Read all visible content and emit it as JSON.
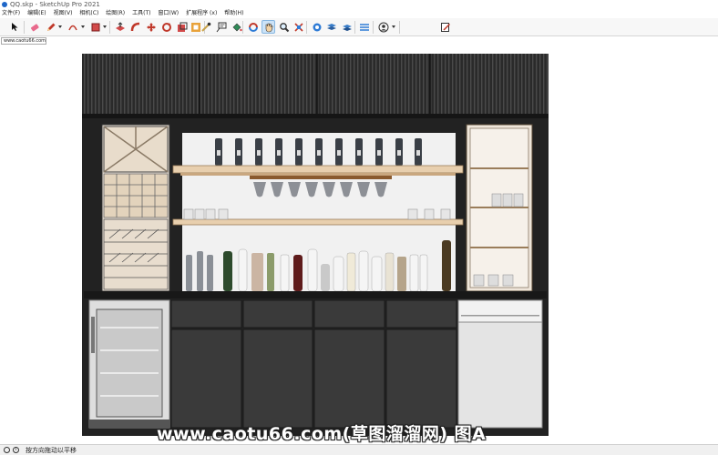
{
  "window": {
    "title": "QQ.skp - SketchUp Pro 2021"
  },
  "menu": [
    "文件(F)",
    "编辑(E)",
    "视图(V)",
    "相机(C)",
    "绘图(R)",
    "工具(T)",
    "窗口(W)",
    "扩展程序 (x)",
    "帮助(H)"
  ],
  "toolbar": {
    "tools": [
      "select-icon",
      "eraser-icon",
      "pencil-icon",
      "arc-icon",
      "shape-icon",
      "push-pull-icon",
      "follow-me-icon",
      "move-icon",
      "rotate-icon",
      "scale-icon",
      "tape-measure-icon",
      "text-icon",
      "paint-bucket-icon",
      "orbit-icon",
      "pan-icon",
      "zoom-icon",
      "zoom-extents-icon",
      "warehouse-icon",
      "extension-warehouse-icon",
      "layout-icon",
      "styles-icon",
      "user-icon",
      "edit-note-icon"
    ],
    "active_tool": "pan-icon"
  },
  "scene_tab": {
    "label": "www.caotu66.com"
  },
  "status": {
    "hint": "按方向拖动以平移"
  },
  "watermark": {
    "text": "www.caotu66.com(草图溜溜网) 图A"
  },
  "colors": {
    "cabinet_dark": "#2b2b2b",
    "shelf_wood": "#e8cfae",
    "backpanel": "#f1f1f1",
    "accent_blue": "#1e66c8"
  }
}
